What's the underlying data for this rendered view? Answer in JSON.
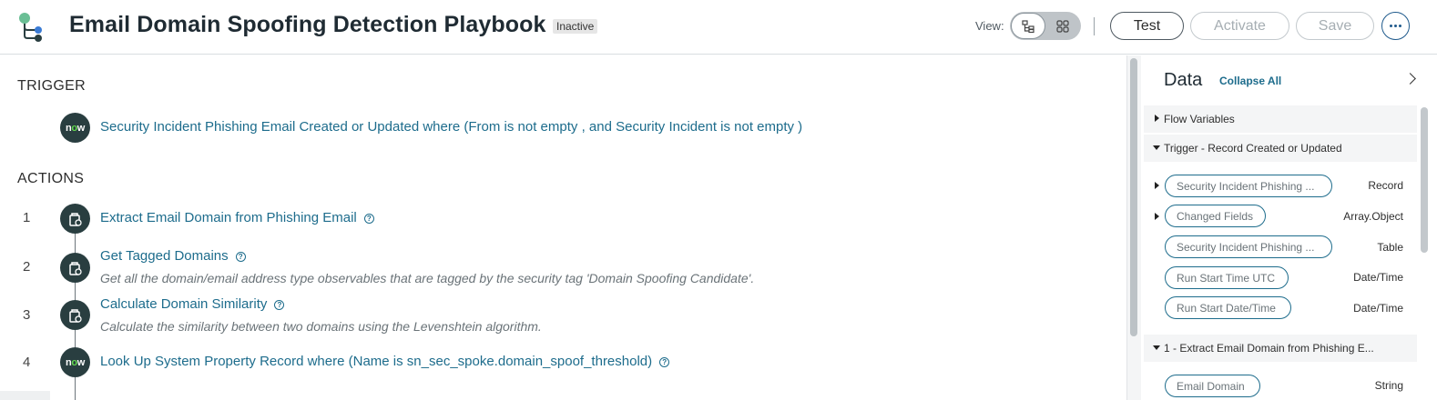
{
  "header": {
    "title": "Email Domain Spoofing Detection Playbook",
    "status": "Inactive",
    "view_label": "View:",
    "buttons": {
      "test": "Test",
      "activate": "Activate",
      "save": "Save"
    }
  },
  "trigger": {
    "heading": "TRIGGER",
    "label": "Security Incident Phishing Email Created or Updated where (From is not empty , and Security Incident is not empty )"
  },
  "actions": {
    "heading": "ACTIONS",
    "items": [
      {
        "num": "1",
        "label": "Extract Email Domain from Phishing Email",
        "desc": ""
      },
      {
        "num": "2",
        "label": "Get Tagged Domains",
        "desc": "Get all the domain/email address type observables that are tagged by the security tag 'Domain Spoofing Candidate'."
      },
      {
        "num": "3",
        "label": "Calculate Domain Similarity",
        "desc": "Calculate the similarity between two domains using the Levenshtein algorithm."
      },
      {
        "num": "4",
        "label": "Look Up System Property Record where (Name is sn_sec_spoke.domain_spoof_threshold)",
        "desc": ""
      }
    ]
  },
  "data_panel": {
    "title": "Data",
    "collapse_all": "Collapse All",
    "groups": [
      {
        "label": "Flow Variables",
        "expanded": false
      },
      {
        "label": "Trigger - Record Created or Updated",
        "expanded": true
      },
      {
        "label": "1 - Extract Email Domain from Phishing E...",
        "expanded": true
      }
    ],
    "trigger_pills": [
      {
        "label": "Security Incident Phishing ...",
        "type": "Record"
      },
      {
        "label": "Changed Fields",
        "type": "Array.Object"
      },
      {
        "label": "Security Incident Phishing ...",
        "type": "Table"
      },
      {
        "label": "Run Start Time UTC",
        "type": "Date/Time"
      },
      {
        "label": "Run Start Date/Time",
        "type": "Date/Time"
      }
    ],
    "action1_pills": [
      {
        "label": "Email Domain",
        "type": "String"
      }
    ]
  },
  "colors": {
    "link": "#1d6c8c",
    "node": "#293e40",
    "now_accent": "#62d84e"
  },
  "icons": [
    "flow-logo-icon",
    "list-view-icon",
    "diagram-view-icon",
    "more-icon",
    "now-logo-icon",
    "action-icon",
    "help-icon",
    "chevron-right-icon",
    "caret-right-icon",
    "caret-down-icon"
  ]
}
